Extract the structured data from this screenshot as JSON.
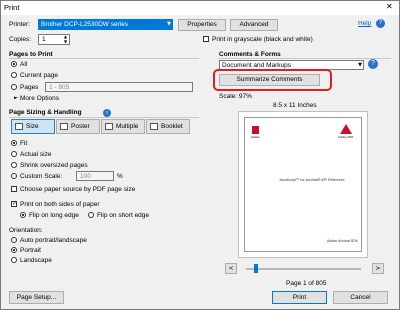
{
  "window": {
    "title": "Print",
    "close_glyph": "✕"
  },
  "printer": {
    "label": "Printer:",
    "value": "Brother DCP-L2530DW series",
    "properties": "Properties",
    "advanced": "Advanced",
    "help": "Help"
  },
  "copies": {
    "label": "Copies:",
    "value": "1",
    "grayscale": "Print in grayscale (black and white)"
  },
  "pages": {
    "heading": "Pages to Print",
    "all": "All",
    "current": "Current page",
    "pages": "Pages",
    "pages_value": "1 - 805",
    "more": "More Options"
  },
  "sizing": {
    "heading": "Page Sizing & Handling",
    "tabs": [
      "Size",
      "Poster",
      "Multiple",
      "Booklet"
    ],
    "fit": "Fit",
    "actual": "Actual size",
    "shrink": "Shrink oversized pages",
    "custom": "Custom Scale:",
    "custom_value": "100",
    "percent": "%",
    "choose_source": "Choose paper source by PDF page size"
  },
  "duplex": {
    "both_sides": "Print on both sides of paper",
    "long_edge": "Flip on long edge",
    "short_edge": "Flip on short edge"
  },
  "orientation": {
    "heading": "Orientation:",
    "auto": "Auto portrait/landscape",
    "portrait": "Portrait",
    "landscape": "Landscape"
  },
  "comments": {
    "heading": "Comments & Forms",
    "value": "Document and Markups",
    "summarize": "Summarize Comments"
  },
  "preview": {
    "scale": "Scale:  97%",
    "paper": "8.5 x 11 Inches",
    "page_title": "JavaScript™ for Acrobat® API Reference",
    "footer": "Adobe Acrobat SDK",
    "page_info": "Page 1 of 805",
    "logo1": "Adobe",
    "logo2": "Adobe PDF"
  },
  "footer": {
    "page_setup": "Page Setup...",
    "print": "Print",
    "cancel": "Cancel"
  },
  "colors": {
    "highlight": "#e02020",
    "accent": "#0078d7"
  }
}
